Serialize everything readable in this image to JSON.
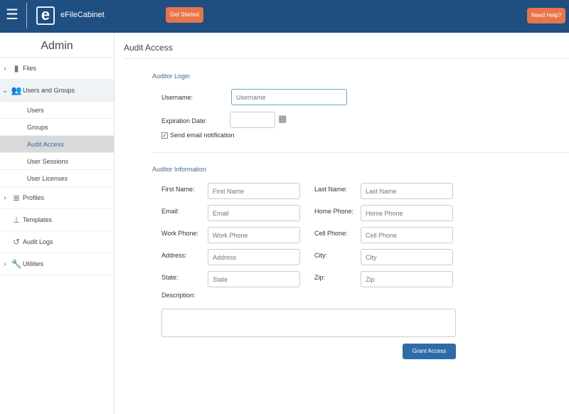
{
  "header": {
    "brand": "eFileCabinet",
    "logo_letter": "e",
    "get_started": "Get Started",
    "need_help": "Need Help?"
  },
  "sidebar": {
    "title": "Admin",
    "items": [
      {
        "label": "Files",
        "icon": "file-icon"
      },
      {
        "label": "Users and Groups",
        "icon": "users-icon"
      },
      {
        "label": "Profiles",
        "icon": "list-icon"
      },
      {
        "label": "Templates",
        "icon": "hierarchy-icon"
      },
      {
        "label": "Audit Logs",
        "icon": "history-icon"
      },
      {
        "label": "Utilities",
        "icon": "wrench-icon"
      }
    ],
    "subitems": [
      "Users",
      "Groups",
      "Audit Access",
      "User Sessions",
      "User Licenses"
    ]
  },
  "main": {
    "title": "Audit Access",
    "login": {
      "heading": "Auditor Login",
      "username_label": "Username:",
      "username_placeholder": "Username",
      "expiration_label": "Expiration Date:",
      "send_email": "Send email notification"
    },
    "info": {
      "heading": "Auditor Information",
      "fields": [
        {
          "label": "First Name:",
          "placeholder": "First Name"
        },
        {
          "label": "Last Name:",
          "placeholder": "Last Name"
        },
        {
          "label": "Email:",
          "placeholder": "Email"
        },
        {
          "label": "Home Phone:",
          "placeholder": "Home Phone"
        },
        {
          "label": "Work Phone:",
          "placeholder": "Work Phone"
        },
        {
          "label": "Cell Phone:",
          "placeholder": "Cell Phone"
        },
        {
          "label": "Address:",
          "placeholder": "Address"
        },
        {
          "label": "City:",
          "placeholder": "City"
        },
        {
          "label": "State:",
          "placeholder": "State"
        },
        {
          "label": "Zip:",
          "placeholder": "Zip"
        }
      ],
      "description_label": "Description:"
    },
    "grant_access": "Grant Access"
  }
}
